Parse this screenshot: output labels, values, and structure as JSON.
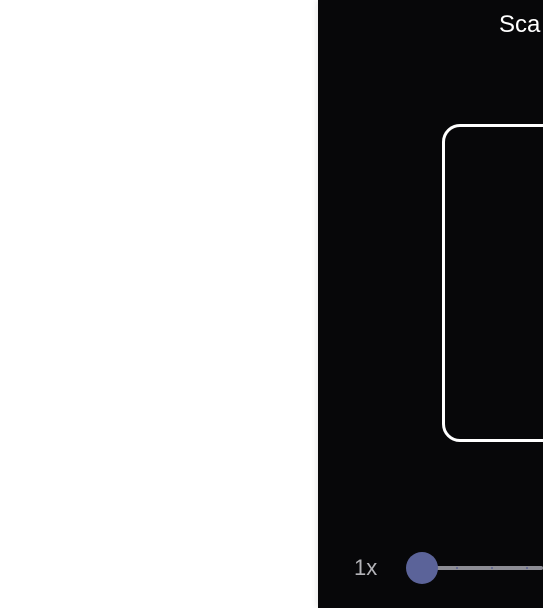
{
  "scanner": {
    "title": "Sca",
    "zoom": {
      "label": "1x",
      "level": 0
    }
  },
  "colors": {
    "panel_background": "#070709",
    "frame_border": "#ffffff",
    "slider_track": "#8d8d95",
    "slider_thumb": "#5b6399",
    "zoom_label": "#b3b3b8"
  }
}
